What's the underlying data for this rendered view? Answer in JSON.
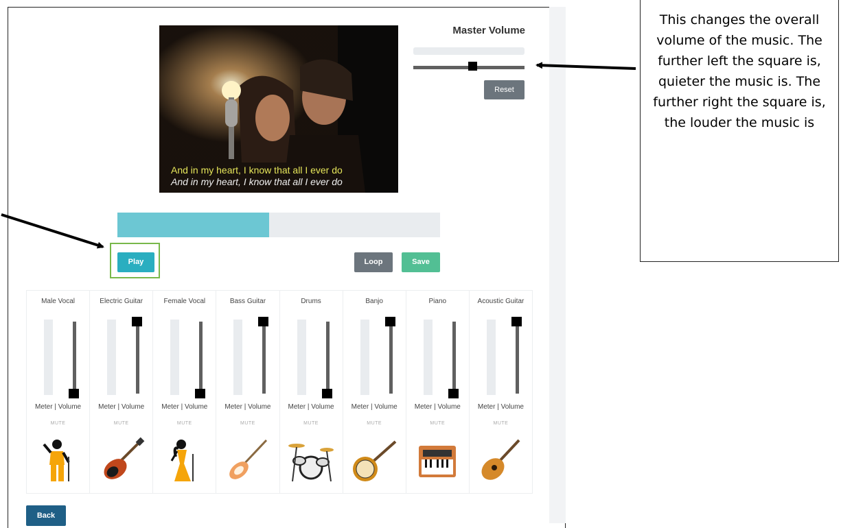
{
  "video": {
    "subtitle_line1": "And in my heart, I know that all I ever do",
    "subtitle_line2": "And in my heart, I know that all I ever do"
  },
  "master_volume": {
    "title": "Master Volume",
    "value_fraction": 0.53,
    "reset_label": "Reset"
  },
  "playback": {
    "progress_fraction": 0.47,
    "play_label": "Play",
    "loop_label": "Loop",
    "save_label": "Save"
  },
  "channels": [
    {
      "name": "Male Vocal",
      "volume": 0.0,
      "icon": "male-singer-icon"
    },
    {
      "name": "Electric Guitar",
      "volume": 1.0,
      "icon": "electric-guitar-icon"
    },
    {
      "name": "Female Vocal",
      "volume": 0.0,
      "icon": "female-singer-icon"
    },
    {
      "name": "Bass Guitar",
      "volume": 1.0,
      "icon": "bass-guitar-icon"
    },
    {
      "name": "Drums",
      "volume": 0.0,
      "icon": "drum-kit-icon"
    },
    {
      "name": "Banjo",
      "volume": 1.0,
      "icon": "banjo-icon"
    },
    {
      "name": "Piano",
      "volume": 0.0,
      "icon": "keyboard-icon"
    },
    {
      "name": "Acoustic Guitar",
      "volume": 1.0,
      "icon": "acoustic-guitar-icon"
    }
  ],
  "channel_labels": {
    "meter_volume": "Meter | Volume",
    "mute": "MUTE"
  },
  "back_label": "Back",
  "callout": {
    "text": "This changes the overall volume of the music. The further left the square is, quieter the music is. The further right the square is, the louder the music is"
  },
  "colors": {
    "progress_fill": "#6cc7d3",
    "play": "#2aaec0",
    "save": "#52bf94",
    "loop": "#6c757d",
    "back": "#1f5f86",
    "highlight": "#78b84a"
  }
}
